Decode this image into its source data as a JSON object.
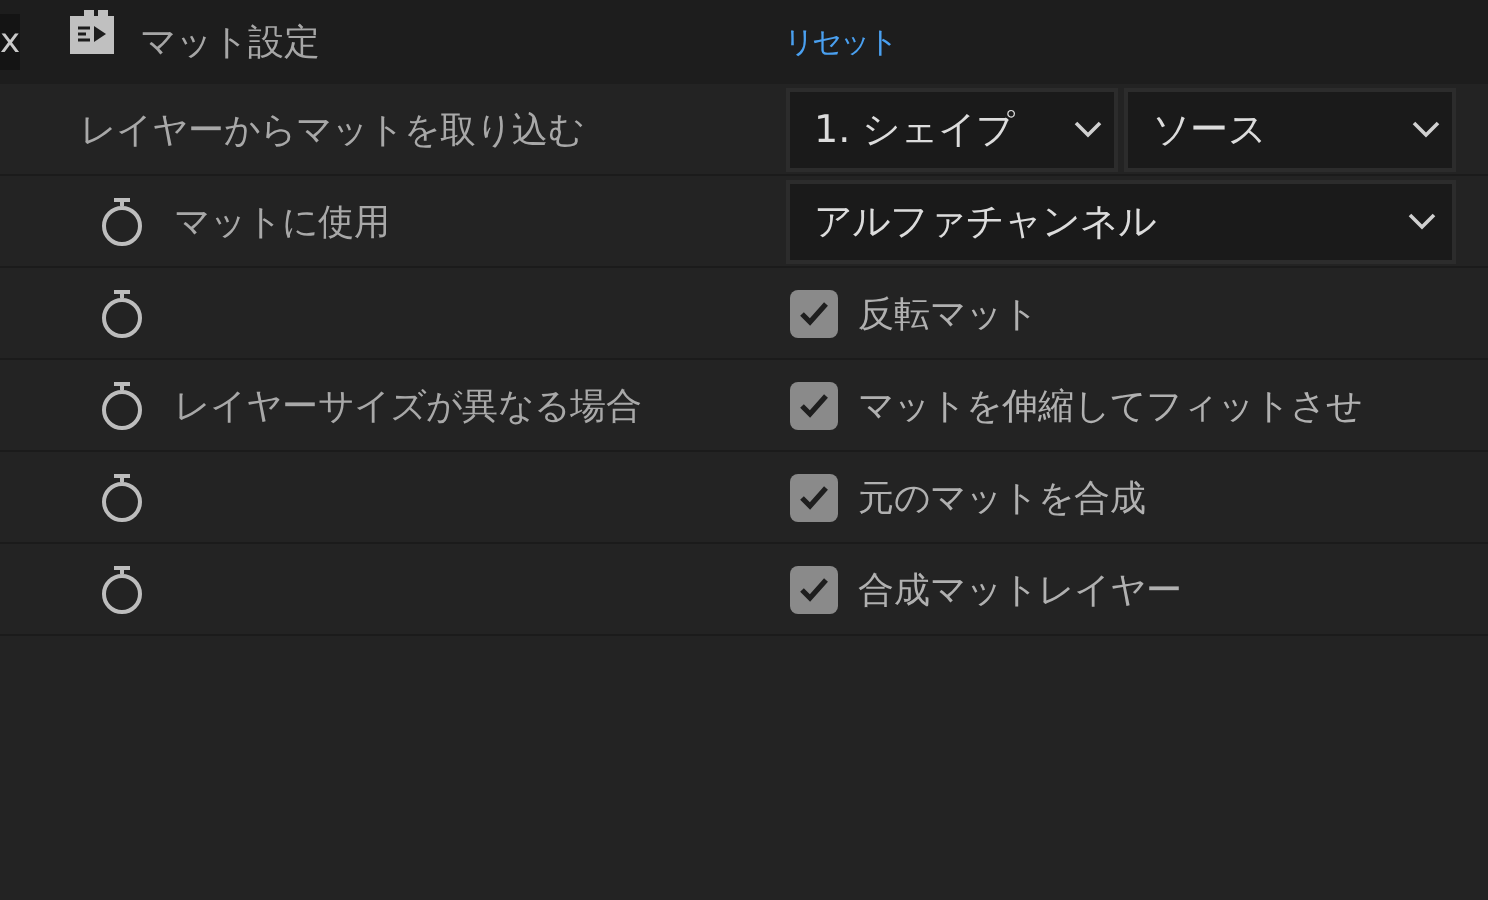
{
  "header": {
    "close_glyph": "x",
    "title": "マット設定",
    "reset_link": "リセット"
  },
  "rows": [
    {
      "kind": "dual_dropdown",
      "animatable": false,
      "label": "レイヤーからマットを取り込む",
      "dropdowns": [
        "1. シェイプ",
        "ソース"
      ]
    },
    {
      "kind": "dropdown",
      "animatable": true,
      "label": "マットに使用",
      "dropdowns": [
        "アルファチャンネル"
      ]
    },
    {
      "kind": "checkbox",
      "animatable": true,
      "checked": true,
      "option": "反転マット"
    },
    {
      "kind": "checkbox",
      "animatable": true,
      "label": "レイヤーサイズが異なる場合",
      "checked": true,
      "option": "マットを伸縮してフィットさせ"
    },
    {
      "kind": "checkbox",
      "animatable": true,
      "checked": true,
      "option": "元のマットを合成"
    },
    {
      "kind": "checkbox",
      "animatable": true,
      "checked": true,
      "option": "合成マットレイヤー"
    }
  ]
}
